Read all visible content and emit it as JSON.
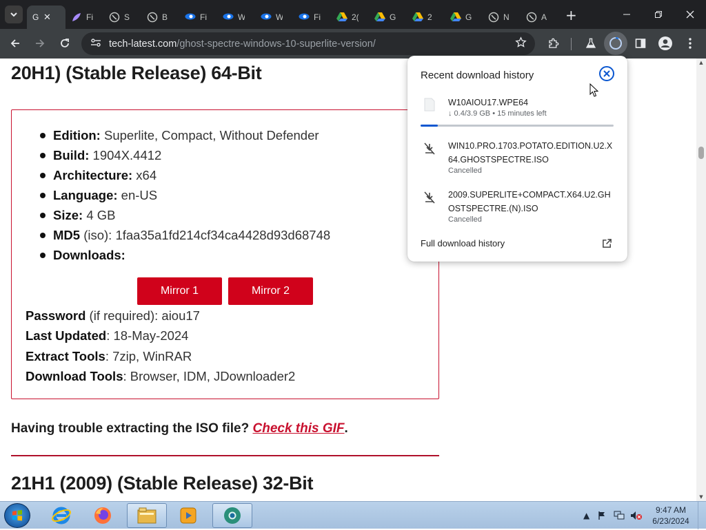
{
  "browser": {
    "active_tab": {
      "title": "G",
      "favicon": "globe-icon"
    },
    "tabs": [
      {
        "title": "Fi",
        "favicon": "purple-feather-icon",
        "color": "#a78bfa"
      },
      {
        "title": "S",
        "favicon": "globe-icon",
        "color": "#9aa0a6"
      },
      {
        "title": "B",
        "favicon": "globe-icon",
        "color": "#9aa0a6"
      },
      {
        "title": "Fi",
        "favicon": "blue-eye-icon",
        "color": "#4285f4"
      },
      {
        "title": "W",
        "favicon": "blue-eye-icon",
        "color": "#4285f4"
      },
      {
        "title": "W",
        "favicon": "blue-eye-icon",
        "color": "#4285f4"
      },
      {
        "title": "Fi",
        "favicon": "blue-eye-icon",
        "color": "#4285f4"
      },
      {
        "title": "2(",
        "favicon": "google-drive-icon",
        "color": "#34a853"
      },
      {
        "title": "G",
        "favicon": "google-drive-icon",
        "color": "#34a853"
      },
      {
        "title": "2",
        "favicon": "google-drive-icon",
        "color": "#34a853"
      },
      {
        "title": "G",
        "favicon": "google-drive-icon",
        "color": "#34a853"
      },
      {
        "title": "N",
        "favicon": "globe-icon",
        "color": "#9aa0a6"
      },
      {
        "title": "A",
        "favicon": "globe-icon",
        "color": "#9aa0a6"
      }
    ],
    "url_host": "tech-latest.com",
    "url_path": "/ghost-spectre-windows-10-superlite-version/"
  },
  "page": {
    "heading_top": "20H1) (Stable Release) 64-Bit",
    "specs": [
      {
        "label": "Edition:",
        "value": " Superlite, Compact, Without Defender"
      },
      {
        "label": "Build:",
        "value": " 1904X.4412"
      },
      {
        "label": "Architecture:",
        "value": " x64"
      },
      {
        "label": "Language:",
        "value": " en-US"
      },
      {
        "label": "Size:",
        "value": " 4 GB"
      },
      {
        "label": "MD5",
        "value": " (iso): 1faa35a1fd214cf34ca4428d93d68748"
      },
      {
        "label": "Downloads:",
        "value": ""
      }
    ],
    "mirror1": "Mirror 1",
    "mirror2": "Mirror 2",
    "info": [
      {
        "label": "Password",
        "value": " (if required): aiou17"
      },
      {
        "label": "Last Updated",
        "value": ": 18-May-2024"
      },
      {
        "label": "Extract Tools",
        "value": ": 7zip, WinRAR"
      },
      {
        "label": "Download Tools",
        "value": ": Browser, IDM, JDownloader2"
      }
    ],
    "trouble_text": "Having trouble extracting the ISO file? ",
    "trouble_link": "Check this GIF",
    "trouble_end": ".",
    "heading_bottom": "21H1 (2009) (Stable Release) 32-Bit"
  },
  "downloads": {
    "title": "Recent download history",
    "items": [
      {
        "name": "W10AIOU17.WPE64",
        "status": "↓ 0.4/3.9 GB • 15 minutes left",
        "progress": 0.09
      },
      {
        "name": "WIN10.PRO.1703.POTATO.EDITION.U2.X64.GHOSTSPECTRE.ISO",
        "status": "Cancelled"
      },
      {
        "name": "2009.SUPERLITE+COMPACT.X64.U2.GHOSTSPECTRE.(N).ISO",
        "status": "Cancelled"
      }
    ],
    "full_history": "Full download history"
  },
  "taskbar": {
    "time": "9:47 AM",
    "date": "6/23/2024",
    "apps": [
      "internet-explorer-icon",
      "firefox-icon",
      "file-explorer-icon",
      "media-player-icon",
      "chrome-icon"
    ]
  },
  "colors": {
    "accent_red": "#d0021b",
    "link_blue": "#0b57d0",
    "chrome_dark": "#202124"
  }
}
